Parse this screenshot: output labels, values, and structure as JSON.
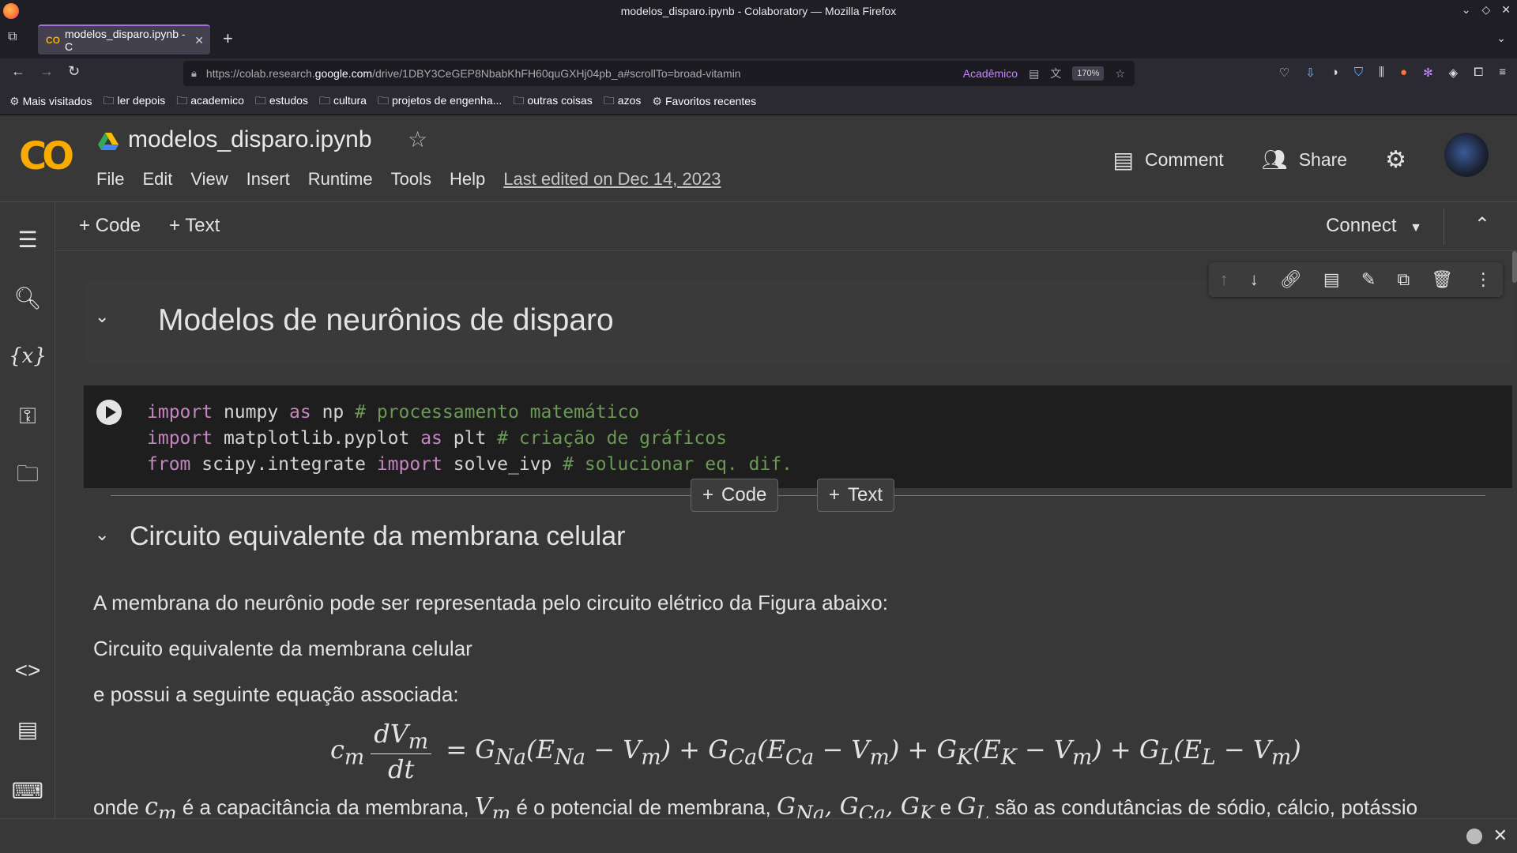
{
  "window": {
    "title": "modelos_disparo.ipynb - Colaboratory — Mozilla Firefox"
  },
  "tab": {
    "title": "modelos_disparo.ipynb - C",
    "favicon": "CO"
  },
  "url": {
    "prefix": "https://colab.research.",
    "host": "google.com",
    "path": "/drive/1DBY3CeGEP8NbabKhFH60quGXHj04pb_a#scrollTo=broad-vitamin",
    "container_label": "Acadêmico",
    "zoom": "170%"
  },
  "bookmarks": [
    "Mais visitados",
    "ler depois",
    "academico",
    "estudos",
    "cultura",
    "projetos de engenha...",
    "outras coisas",
    "azos",
    "Favoritos recentes"
  ],
  "colab": {
    "notebook_title": "modelos_disparo.ipynb",
    "menu": [
      "File",
      "Edit",
      "View",
      "Insert",
      "Runtime",
      "Tools",
      "Help"
    ],
    "last_edited": "Last edited on Dec 14, 2023",
    "comment_label": "Comment",
    "share_label": "Share"
  },
  "toolbar": {
    "add_code": "+ Code",
    "add_text": "+ Text",
    "connect": "Connect"
  },
  "cells": {
    "heading1": "Modelos de neurônios de disparo",
    "code_lines": [
      {
        "kw": "import",
        "a": " numpy ",
        "kw2": "as",
        "b": " np ",
        "cm": "# processamento matemático"
      },
      {
        "kw": "import",
        "a": " matplotlib.pyplot ",
        "kw2": "as",
        "b": " plt ",
        "cm": "# criação de gráficos"
      },
      {
        "kw": "from",
        "a": " scipy.integrate ",
        "kw2": "import",
        "b": " solve_ivp ",
        "cm": "# solucionar eq. dif."
      }
    ],
    "insert_code": "Code",
    "insert_text": "Text",
    "heading2": "Circuito equivalente da membrana celular",
    "para1": "A membrana do neurônio pode ser representada pelo circuito elétrico da Figura abaixo:",
    "para2": "Circuito equivalente da membrana celular",
    "para3": "e possui a seguinte equação associada:",
    "para4_a": "onde ",
    "para4_b": " é a capacitância da membrana, ",
    "para4_c": " é o potencial de membrana, ",
    "para4_d": " e ",
    "para4_e": " são as condutâncias de sódio, cálcio, potássio"
  },
  "colors": {
    "accent": "#f9ab00",
    "background": "#383838",
    "code_bg": "#1e1e1e",
    "keyword": "#c586c0",
    "comment": "#6a9955"
  }
}
